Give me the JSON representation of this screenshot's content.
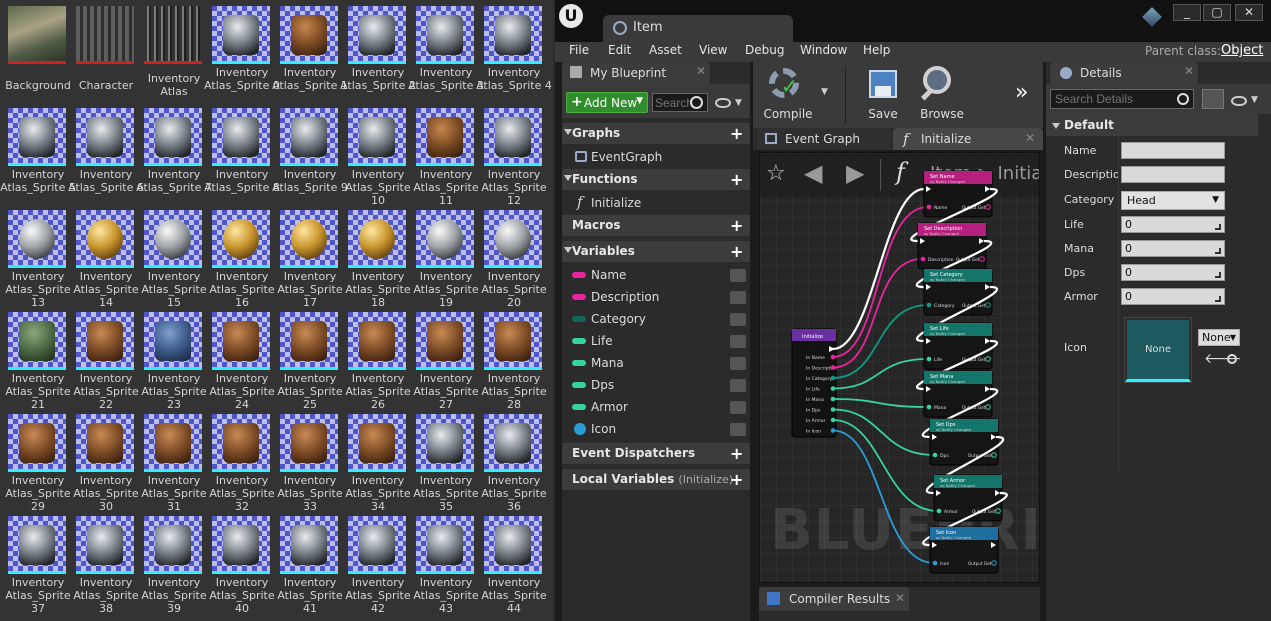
{
  "assets": [
    {
      "label": "Background",
      "kind": "texture",
      "style": "bg"
    },
    {
      "label": "Character",
      "kind": "texture",
      "style": "ch"
    },
    {
      "label": "Inventory Atlas",
      "kind": "texture",
      "style": "at"
    },
    {
      "label": "Inventory Atlas_Sprite 0",
      "kind": "sprite",
      "icon": "sword-icon",
      "style": "steel"
    },
    {
      "label": "Inventory Atlas_Sprite 1",
      "kind": "sprite",
      "icon": "club-icon",
      "style": "wood"
    },
    {
      "label": "Inventory Atlas_Sprite 2",
      "kind": "sprite",
      "icon": "mace-icon",
      "style": "steel"
    },
    {
      "label": "Inventory Atlas_Sprite 3",
      "kind": "sprite",
      "icon": "spiked-mace-icon",
      "style": "steel"
    },
    {
      "label": "Inventory Atlas_Sprite 4",
      "kind": "sprite",
      "icon": "hammer-icon",
      "style": "steel"
    },
    {
      "label": "Inventory Atlas_Sprite 5",
      "kind": "sprite",
      "icon": "war-hammer-icon",
      "style": "steel"
    },
    {
      "label": "Inventory Atlas_Sprite 6",
      "kind": "sprite",
      "icon": "hammer-icon",
      "style": "steel"
    },
    {
      "label": "Inventory Atlas_Sprite 7",
      "kind": "sprite",
      "icon": "axe-icon",
      "style": "steel"
    },
    {
      "label": "Inventory Atlas_Sprite 8",
      "kind": "sprite",
      "icon": "battle-axe-icon",
      "style": "steel"
    },
    {
      "label": "Inventory Atlas_Sprite 9",
      "kind": "sprite",
      "icon": "double-axe-icon",
      "style": "steel"
    },
    {
      "label": "Inventory Atlas_Sprite 10",
      "kind": "sprite",
      "icon": "dagger-icon",
      "style": "steel"
    },
    {
      "label": "Inventory Atlas_Sprite 11",
      "kind": "sprite",
      "icon": "shield-icon",
      "style": "wood"
    },
    {
      "label": "Inventory Atlas_Sprite 12",
      "kind": "sprite",
      "icon": "claw-icon",
      "style": "steel"
    },
    {
      "label": "Inventory Atlas_Sprite 13",
      "kind": "sprite",
      "icon": "ring-icon",
      "style": "silver"
    },
    {
      "label": "Inventory Atlas_Sprite 14",
      "kind": "sprite",
      "icon": "ring-icon",
      "style": "gold"
    },
    {
      "label": "Inventory Atlas_Sprite 15",
      "kind": "sprite",
      "icon": "ring-icon",
      "style": "silver"
    },
    {
      "label": "Inventory Atlas_Sprite 16",
      "kind": "sprite",
      "icon": "ruby-ring-icon",
      "style": "gold"
    },
    {
      "label": "Inventory Atlas_Sprite 17",
      "kind": "sprite",
      "icon": "ring-icon",
      "style": "gold"
    },
    {
      "label": "Inventory Atlas_Sprite 18",
      "kind": "sprite",
      "icon": "emerald-ring-icon",
      "style": "gold"
    },
    {
      "label": "Inventory Atlas_Sprite 19",
      "kind": "sprite",
      "icon": "sapphire-ring-icon",
      "style": "silver"
    },
    {
      "label": "Inventory Atlas_Sprite 20",
      "kind": "sprite",
      "icon": "ring-icon",
      "style": "silver"
    },
    {
      "label": "Inventory Atlas_Sprite 21",
      "kind": "sprite",
      "icon": "tunic-icon",
      "style": "cloth"
    },
    {
      "label": "Inventory Atlas_Sprite 22",
      "kind": "sprite",
      "icon": "gloves-icon",
      "style": "leather"
    },
    {
      "label": "Inventory Atlas_Sprite 23",
      "kind": "sprite",
      "icon": "pants-icon",
      "style": "denim"
    },
    {
      "label": "Inventory Atlas_Sprite 24",
      "kind": "sprite",
      "icon": "sandals-icon",
      "style": "leather"
    },
    {
      "label": "Inventory Atlas_Sprite 25",
      "kind": "sprite",
      "icon": "hood-icon",
      "style": "leather"
    },
    {
      "label": "Inventory Atlas_Sprite 26",
      "kind": "sprite",
      "icon": "shirt-icon",
      "style": "leather"
    },
    {
      "label": "Inventory Atlas_Sprite 27",
      "kind": "sprite",
      "icon": "bracers-icon",
      "style": "leather"
    },
    {
      "label": "Inventory Atlas_Sprite 28",
      "kind": "sprite",
      "icon": "skirt-icon",
      "style": "leather"
    },
    {
      "label": "Inventory Atlas_Sprite 29",
      "kind": "sprite",
      "icon": "boots-icon",
      "style": "leather"
    },
    {
      "label": "Inventory Atlas_Sprite 30",
      "kind": "sprite",
      "icon": "leather-helmet-icon",
      "style": "leather"
    },
    {
      "label": "Inventory Atlas_Sprite 31",
      "kind": "sprite",
      "icon": "leather-armor-icon",
      "style": "leather"
    },
    {
      "label": "Inventory Atlas_Sprite 32",
      "kind": "sprite",
      "icon": "leather-gloves-icon",
      "style": "leather"
    },
    {
      "label": "Inventory Atlas_Sprite 33",
      "kind": "sprite",
      "icon": "leather-pants-icon",
      "style": "leather"
    },
    {
      "label": "Inventory Atlas_Sprite 34",
      "kind": "sprite",
      "icon": "leather-boots-icon",
      "style": "leather"
    },
    {
      "label": "Inventory Atlas_Sprite 35",
      "kind": "sprite",
      "icon": "chain-coif-icon",
      "style": "steel"
    },
    {
      "label": "Inventory Atlas_Sprite 36",
      "kind": "sprite",
      "icon": "chain-mail-icon",
      "style": "steel"
    },
    {
      "label": "Inventory Atlas_Sprite 37",
      "kind": "sprite",
      "icon": "chain-gloves-icon",
      "style": "steel"
    },
    {
      "label": "Inventory Atlas_Sprite 38",
      "kind": "sprite",
      "icon": "chain-skirt-icon",
      "style": "steel"
    },
    {
      "label": "Inventory Atlas_Sprite 39",
      "kind": "sprite",
      "icon": "chain-boots-icon",
      "style": "steel"
    },
    {
      "label": "Inventory Atlas_Sprite 40",
      "kind": "sprite",
      "icon": "plate-helmet-icon",
      "style": "steel"
    },
    {
      "label": "Inventory Atlas_Sprite 41",
      "kind": "sprite",
      "icon": "plate-armor-icon",
      "style": "steel"
    },
    {
      "label": "Inventory Atlas_Sprite 42",
      "kind": "sprite",
      "icon": "plate-gauntlets-icon",
      "style": "steel"
    },
    {
      "label": "Inventory Atlas_Sprite 43",
      "kind": "sprite",
      "icon": "plate-legs-icon",
      "style": "steel"
    },
    {
      "label": "Inventory Atlas_Sprite 44",
      "kind": "sprite",
      "icon": "plate-boots-icon",
      "style": "steel"
    }
  ],
  "window": {
    "logo": "U",
    "tab_title": "Item",
    "buttons": [
      "_",
      "▢",
      "✕"
    ]
  },
  "menu": [
    "File",
    "Edit",
    "Asset",
    "View",
    "Debug",
    "Window",
    "Help"
  ],
  "parent_class": {
    "label": "Parent class:",
    "value": "Object"
  },
  "my_blueprint": {
    "tab_title": "My Blueprint",
    "add_new": "Add New",
    "search_placeholder": "Search",
    "sections": {
      "graphs": "Graphs",
      "functions": "Functions",
      "macros": "Macros",
      "variables": "Variables",
      "event_dispatchers": "Event Dispatchers",
      "local_variables": "Local Variables",
      "local_variables_scope": "(Initialize)"
    },
    "graphs": [
      "EventGraph"
    ],
    "functions": [
      "Initialize"
    ],
    "variables": [
      {
        "name": "Name",
        "color": "#e8259f"
      },
      {
        "name": "Description",
        "color": "#e8259f"
      },
      {
        "name": "Category",
        "color": "#0f6659"
      },
      {
        "name": "Life",
        "color": "#37d39f"
      },
      {
        "name": "Mana",
        "color": "#37d39f"
      },
      {
        "name": "Dps",
        "color": "#37d39f"
      },
      {
        "name": "Armor",
        "color": "#37d39f"
      },
      {
        "name": "Icon",
        "color": "#2c9cd6"
      }
    ]
  },
  "toolbar": {
    "compile": "Compile",
    "save": "Save",
    "browse": "Browse"
  },
  "graph_tabs": {
    "event_graph": "Event Graph",
    "initialize": "Initialize"
  },
  "graph": {
    "breadcrumb": "Item > Initia",
    "watermark": "BLUEPRIN",
    "entry_node": {
      "title": "Initialize",
      "pins": [
        "In Name",
        "In Description",
        "In Category",
        "In Life",
        "In Mana",
        "In Dps",
        "In Armor",
        "In Icon"
      ]
    },
    "set_nodes": [
      {
        "title": "Set Name",
        "sub": "w/ Notify Changed",
        "pin": "Name",
        "color": "#b5207e"
      },
      {
        "title": "Set Description",
        "sub": "w/ Notify Changed",
        "pin": "Description",
        "color": "#b5207e"
      },
      {
        "title": "Set Category",
        "sub": "w/ Notify Changed",
        "pin": "Category",
        "color": "#14766a"
      },
      {
        "title": "Set Life",
        "sub": "w/ Notify Changed",
        "pin": "Life",
        "color": "#14766a"
      },
      {
        "title": "Set Mana",
        "sub": "w/ Notify Changed",
        "pin": "Mana",
        "color": "#14766a"
      },
      {
        "title": "Set Dps",
        "sub": "w/ Notify Changed",
        "pin": "Dps",
        "color": "#14766a"
      },
      {
        "title": "Set Armor",
        "sub": "w/ Notify Changed",
        "pin": "Armor",
        "color": "#14766a"
      },
      {
        "title": "Set Icon",
        "sub": "w/ Notify Changed",
        "pin": "Icon",
        "color": "#1e6fa0"
      }
    ],
    "output_label": "Output Get"
  },
  "compiler": {
    "tab_title": "Compiler Results"
  },
  "details": {
    "tab_title": "Details",
    "search_placeholder": "Search Details",
    "category": "Default",
    "props": {
      "name_label": "Name",
      "name_value": "",
      "description_label": "Description",
      "description_value": "",
      "category_label": "Category",
      "category_value": "Head",
      "life_label": "Life",
      "life_value": "0",
      "mana_label": "Mana",
      "mana_value": "0",
      "dps_label": "Dps",
      "dps_value": "0",
      "armor_label": "Armor",
      "armor_value": "0",
      "icon_label": "Icon",
      "icon_value": "None",
      "icon_dropdown": "None"
    }
  }
}
